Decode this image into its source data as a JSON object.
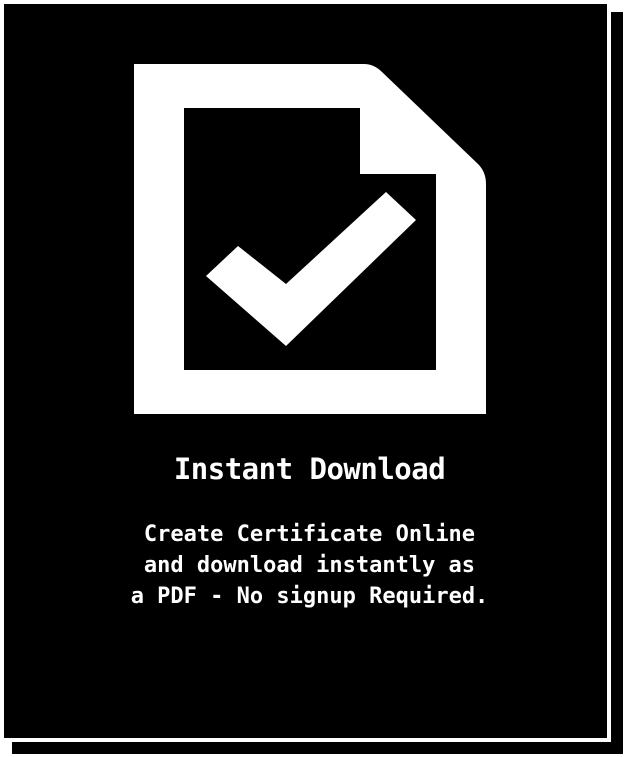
{
  "card": {
    "icon": "document-check-icon",
    "title": "Instant Download",
    "description_lines": [
      "Create Certificate Online",
      "and download instantly as",
      "a PDF - No signup Required."
    ]
  },
  "colors": {
    "background": "#000000",
    "foreground": "#ffffff"
  }
}
